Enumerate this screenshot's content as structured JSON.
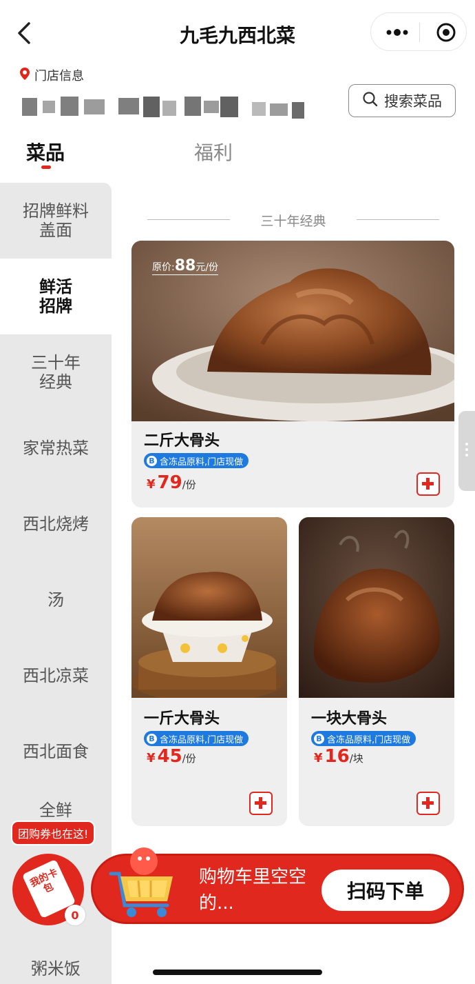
{
  "header": {
    "title": "九毛九西北菜"
  },
  "store": {
    "label": "门店信息",
    "search_label": "搜索菜品"
  },
  "tabs": [
    {
      "label": "菜品"
    },
    {
      "label": "福利"
    }
  ],
  "sidebar": {
    "items": [
      {
        "label": "招牌鲜料盖面"
      },
      {
        "label": "鲜活招牌"
      },
      {
        "label": "三十年经典"
      },
      {
        "label": "家常热菜"
      },
      {
        "label": "西北烧烤"
      },
      {
        "label": "汤"
      },
      {
        "label": "西北凉菜"
      },
      {
        "label": "西北面食"
      },
      {
        "label": "全鲜"
      },
      {
        "label": "粥米饭"
      }
    ]
  },
  "section": {
    "title": "三十年经典"
  },
  "products": [
    {
      "name": "二斤大骨头",
      "badge": "含冻品原料,门店现做",
      "badge_letter": "B",
      "currency": "¥",
      "price": "79",
      "unit": "/份",
      "original_label": "原价:",
      "original_price": "88",
      "original_unit": "元/份"
    },
    {
      "name": "一斤大骨头",
      "badge": "含冻品原料,门店现做",
      "badge_letter": "B",
      "currency": "¥",
      "price": "45",
      "unit": "/份"
    },
    {
      "name": "一块大骨头",
      "badge": "含冻品原料,门店现做",
      "badge_letter": "B",
      "currency": "¥",
      "price": "16",
      "unit": "/块"
    }
  ],
  "cart": {
    "coupon_tag": "团购券也在这!",
    "card_pack_label": "我的卡包",
    "count": "0",
    "empty_text": "购物车里空空的...",
    "scan_label": "扫码下单"
  },
  "colors": {
    "accent": "#e0281e",
    "badge": "#1f7ae0",
    "sidebar_bg": "#e8e8e8"
  }
}
